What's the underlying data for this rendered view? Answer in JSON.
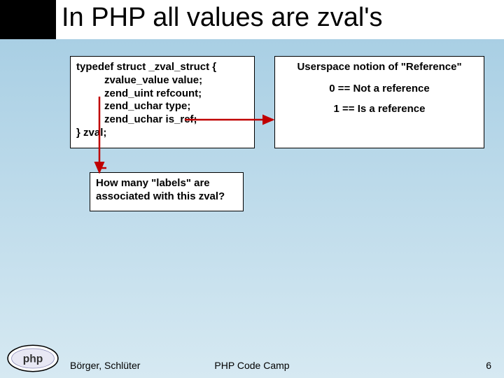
{
  "title": "In PHP all values are zval's",
  "struct": {
    "line1": "typedef struct _zval_struct {",
    "line2": "zvalue_value value;",
    "line3": "zend_uint refcount;",
    "line4": "zend_uchar type;",
    "line5": "zend_uchar is_ref;",
    "line6": "} zval;"
  },
  "refbox": {
    "title": "Userspace notion of \"Reference\"",
    "not_ref": "0 == Not a reference",
    "is_ref": "1 == Is a reference"
  },
  "labels_box": {
    "line1": "How many \"labels\" are",
    "line2": "associated with this zval?"
  },
  "footer": {
    "authors": "Börger, Schlüter",
    "center": "PHP Code Camp",
    "page": "6"
  },
  "logo_text": "php",
  "colors": {
    "arrow": "#c00000"
  }
}
